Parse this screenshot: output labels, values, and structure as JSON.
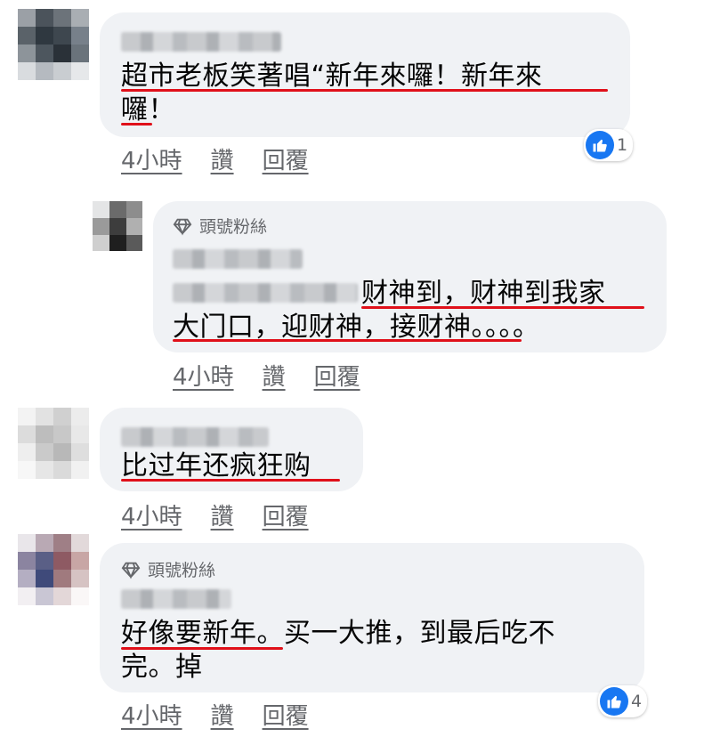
{
  "comments": [
    {
      "text_line1": "超市老板笑著唱“新年來囉！新年來",
      "text_line2": "囉！",
      "reaction_count": "1",
      "actions": {
        "time": "4小時",
        "like": "讚",
        "reply": "回覆"
      }
    },
    {
      "badge": "頭號粉絲",
      "text_line1": "财神到，财神到我家",
      "text_line2": "大门口，迎财神，接财神。。。。",
      "actions": {
        "time": "4小時",
        "like": "讚",
        "reply": "回覆"
      }
    },
    {
      "text_line1": "比过年还疯狂购",
      "actions": {
        "time": "4小時",
        "like": "讚",
        "reply": "回覆"
      }
    },
    {
      "badge": "頭號粉絲",
      "text_line1": "好像要新年。买一大推，到最后吃不",
      "text_line2": "完。掉",
      "reaction_count": "4",
      "actions": {
        "time": "4小時",
        "like": "讚",
        "reply": "回覆"
      }
    }
  ],
  "icons": {
    "like": "thumbs-up-icon",
    "badge": "diamond-icon"
  },
  "colors": {
    "bubble": "#f0f2f5",
    "underline": "#e0101a",
    "like_blue": "#1877f2",
    "meta_text": "#65676b"
  }
}
